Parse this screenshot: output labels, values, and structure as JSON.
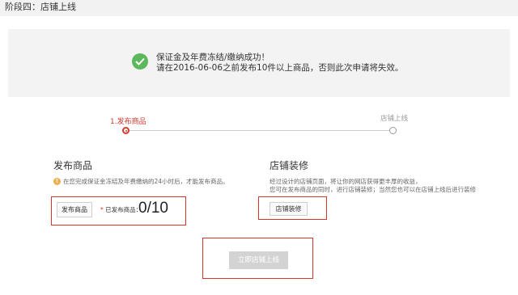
{
  "header": {
    "stage_title": "阶段四：店铺上线"
  },
  "notice": {
    "line1": "保证金及年费冻结/缴纳成功！",
    "line2": "请在2016-06-06之前发布10件以上商品，否则此次申请将失效。",
    "icon": "check-circle-icon",
    "icon_color": "#5cb85c"
  },
  "steps": [
    {
      "label": "1.发布商品",
      "active": true
    },
    {
      "label": "店铺上线",
      "active": false
    }
  ],
  "publish_section": {
    "title": "发布商品",
    "note": "在您完成保证金冻结及年费缴纳的24小时后，才能发布商品。",
    "info_icon_text": "!",
    "button_label": "发布商品",
    "star": "*",
    "published_label": "已发布商品：",
    "published_count": "0/10"
  },
  "decorate_section": {
    "title": "店铺装修",
    "note_line1": "经过设计的店铺页面，将让你的网店获得更丰厚的收益，",
    "note_line2": "您可在发布商品的同时，进行店铺装修；当然您也可以在店铺上线后进行装修",
    "button_label": "店铺装修"
  },
  "go_live_button": {
    "label": "立即店铺上线"
  },
  "colors": {
    "accent_red": "#d43a2f",
    "highlight_box": "#d9342b",
    "disabled_button": "#d3d3d3"
  }
}
